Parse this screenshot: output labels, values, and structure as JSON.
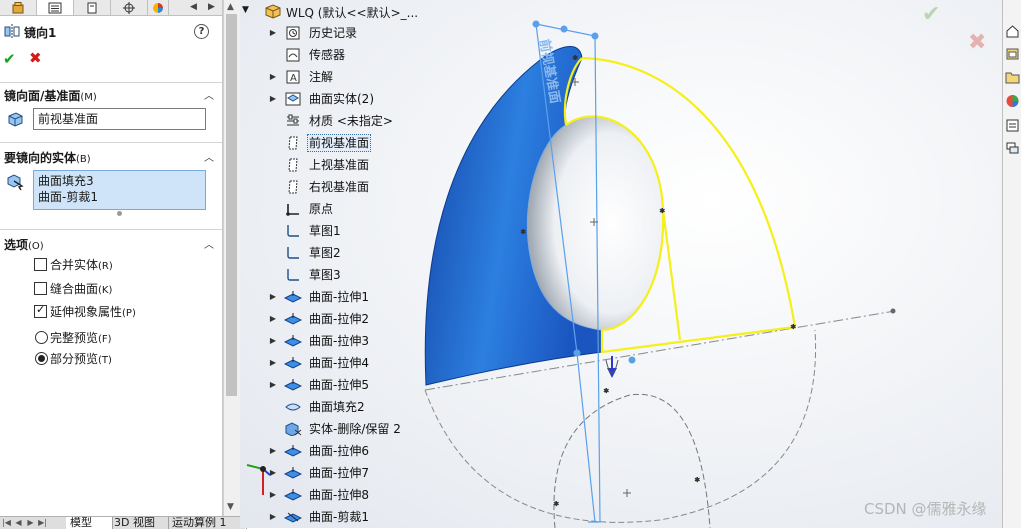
{
  "property_manager": {
    "tabs": [
      "feature-manager",
      "property-manager",
      "configuration-manager",
      "dimxpert-manager",
      "display-manager"
    ],
    "title": "镜向1",
    "help": "?",
    "ok": "✔",
    "cancel": "✖",
    "mirror_face": {
      "heading": "镜向面/基准面",
      "key": "(M)",
      "value": "前视基准面"
    },
    "bodies": {
      "heading": "要镜向的实体",
      "key": "(B)",
      "items": [
        "曲面填充3",
        "曲面-剪裁1"
      ]
    },
    "options": {
      "heading": "选项",
      "key": "(O)",
      "checkboxes": [
        {
          "label": "合并实体",
          "key": "(R)",
          "checked": false
        },
        {
          "label": "缝合曲面",
          "key": "(K)",
          "checked": false
        },
        {
          "label": "延伸视象属性",
          "key": "(P)",
          "checked": true
        }
      ],
      "radios": [
        {
          "label": "完整预览",
          "key": "(F)",
          "selected": false
        },
        {
          "label": "部分预览",
          "key": "(T)",
          "selected": true
        }
      ]
    }
  },
  "bottom_tabs": [
    "模型",
    "3D 视图",
    "运动算例 1"
  ],
  "tree": {
    "root": "WLQ (默认<<默认>_...",
    "items": [
      {
        "label": "历史记录",
        "icon": "history-icon",
        "expandable": true
      },
      {
        "label": "传感器",
        "icon": "sensor-icon",
        "expandable": false
      },
      {
        "label": "注解",
        "icon": "annotation-icon",
        "expandable": true
      },
      {
        "label": "曲面实体(2)",
        "icon": "surface-bodies-icon",
        "expandable": true
      },
      {
        "label": "材质 <未指定>",
        "icon": "material-icon",
        "expandable": false
      },
      {
        "label": "前视基准面",
        "icon": "plane-icon",
        "expandable": false,
        "selected": true
      },
      {
        "label": "上视基准面",
        "icon": "plane-icon",
        "expandable": false
      },
      {
        "label": "右视基准面",
        "icon": "plane-icon",
        "expandable": false
      },
      {
        "label": "原点",
        "icon": "origin-icon",
        "expandable": false
      },
      {
        "label": "草图1",
        "icon": "sketch-icon",
        "expandable": false
      },
      {
        "label": "草图2",
        "icon": "sketch-icon",
        "expandable": false
      },
      {
        "label": "草图3",
        "icon": "sketch-icon",
        "expandable": false
      },
      {
        "label": "曲面-拉伸1",
        "icon": "surface-extrude-icon",
        "expandable": true
      },
      {
        "label": "曲面-拉伸2",
        "icon": "surface-extrude-icon",
        "expandable": true
      },
      {
        "label": "曲面-拉伸3",
        "icon": "surface-extrude-icon",
        "expandable": true
      },
      {
        "label": "曲面-拉伸4",
        "icon": "surface-extrude-icon",
        "expandable": true
      },
      {
        "label": "曲面-拉伸5",
        "icon": "surface-extrude-icon",
        "expandable": true
      },
      {
        "label": "曲面填充2",
        "icon": "surface-fill-icon",
        "expandable": false
      },
      {
        "label": "实体-删除/保留 2",
        "icon": "delete-body-icon",
        "expandable": false
      },
      {
        "label": "曲面-拉伸6",
        "icon": "surface-extrude-icon",
        "expandable": true
      },
      {
        "label": "曲面-拉伸7",
        "icon": "surface-extrude-icon",
        "expandable": true
      },
      {
        "label": "曲面-拉伸8",
        "icon": "surface-extrude-icon",
        "expandable": true
      },
      {
        "label": "曲面-剪裁1",
        "icon": "surface-trim-icon",
        "expandable": true
      }
    ]
  },
  "graphics": {
    "plane_label": "前视基准面",
    "confirm_ok": "✔",
    "confirm_cancel": "✖",
    "colors": {
      "surface": "#1f63c9",
      "edge_highlight": "#f5ef1a",
      "plane_outline": "#5aa0ea"
    }
  },
  "watermark": "CSDN @儒雅永缘"
}
